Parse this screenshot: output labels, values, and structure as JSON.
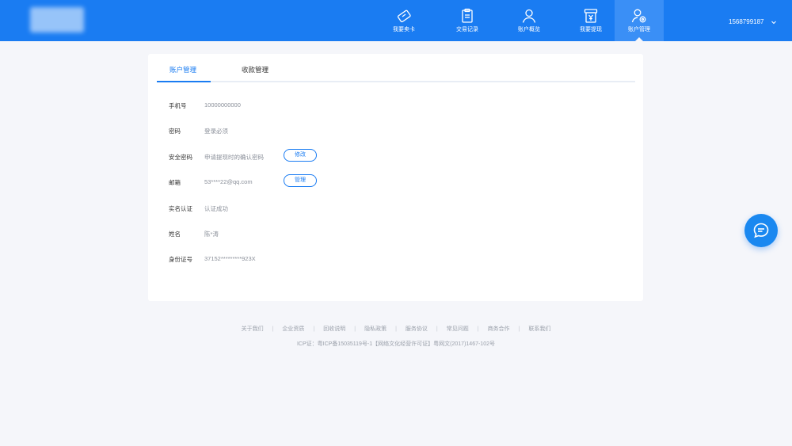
{
  "header": {
    "logo_text": "",
    "nav": [
      {
        "label": "我要卖卡",
        "icon": "ticket-icon"
      },
      {
        "label": "交易记录",
        "icon": "clipboard-icon"
      },
      {
        "label": "账户概览",
        "icon": "user-icon"
      },
      {
        "label": "我要提现",
        "icon": "withdraw-icon"
      },
      {
        "label": "账户管理",
        "icon": "user-settings-icon",
        "active": true
      }
    ],
    "phone": "1568799187"
  },
  "tabs": [
    {
      "label": "账户管理",
      "active": true
    },
    {
      "label": "收款管理",
      "active": false
    }
  ],
  "account": {
    "rows": [
      {
        "label": "手机号",
        "value": "10000000000"
      },
      {
        "label": "密码",
        "value": "登录必须"
      },
      {
        "label": "安全密码",
        "value": "申请提现时的确认密码",
        "button": "修改"
      },
      {
        "label": "邮箱",
        "value": "53****22@qq.com",
        "button": "管理"
      },
      {
        "label": "实名认证",
        "value": "认证成功"
      },
      {
        "label": "姓名",
        "value": "陈*涛"
      },
      {
        "label": "身份证号",
        "value": "37152*********923X"
      }
    ]
  },
  "footer": {
    "links": [
      "关于我们",
      "企业资质",
      "回收说明",
      "隐私政策",
      "服务协议",
      "常见问题",
      "商务合作",
      "联系我们"
    ],
    "icp": "ICP证：粤ICP备15035119号-1【网络文化经营许可证】粤网文(2017)1467-102号"
  },
  "colors": {
    "primary": "#1a7cf2",
    "background": "#f5f6fa",
    "text_muted": "#8a8f99"
  }
}
